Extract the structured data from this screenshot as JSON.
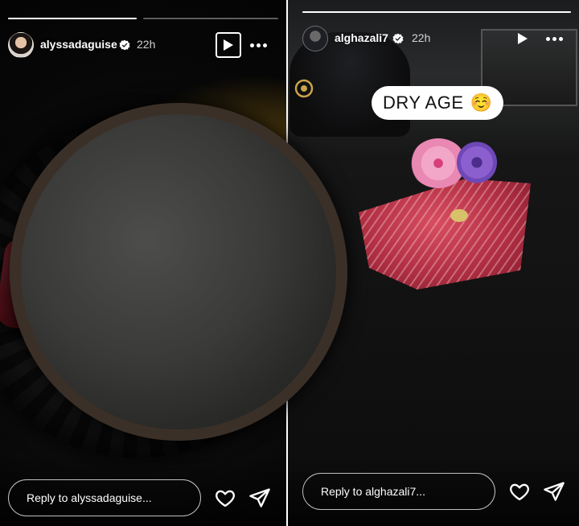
{
  "stories": [
    {
      "username": "alyssadaguise",
      "time": "22h",
      "reply_placeholder": "Reply to alyssadaguise...",
      "progress": [
        1.0,
        0.0
      ],
      "icons": {
        "play": "play-icon",
        "more": "more-icon",
        "verified": "verified-badge-icon",
        "like": "heart-icon",
        "share": "send-icon"
      }
    },
    {
      "username": "alghazali7",
      "time": "22h",
      "caption": "DRY AGE",
      "caption_emoji": "☺️",
      "reply_placeholder": "Reply to alghazali7...",
      "progress": [
        1.0
      ],
      "icons": {
        "play": "play-icon",
        "more": "more-icon",
        "verified": "verified-badge-icon",
        "like": "heart-icon",
        "share": "send-icon"
      }
    }
  ],
  "colors": {
    "accent": "#ffffff",
    "caption_bg": "#ffffff"
  }
}
